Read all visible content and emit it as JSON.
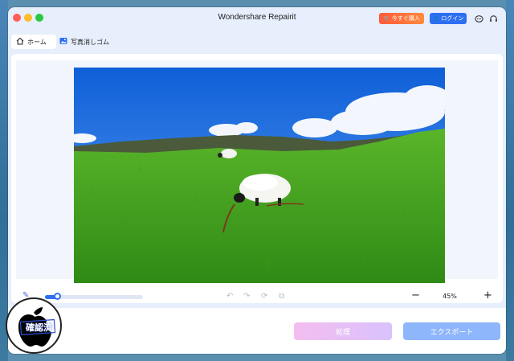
{
  "window": {
    "title": "Wondershare Repairit",
    "buy_label": "今すぐ購入",
    "login_label": "ログイン"
  },
  "tabs": [
    {
      "label": "ホーム",
      "icon": "home-icon",
      "active": true
    },
    {
      "label": "写真消しゴム",
      "icon": "image-icon",
      "active": false
    }
  ],
  "toolbar": {
    "brush_size_percent": 12,
    "zoom": "45%",
    "zoom_out_label": "−",
    "zoom_in_label": "+"
  },
  "footer": {
    "process_label": "処理",
    "export_label": "エクスポート"
  },
  "watermark": {
    "text": "確認済"
  },
  "colors": {
    "accent": "#2d6ff3",
    "buy_orange": "#ff6a3c",
    "export_blue": "#8eb6fb",
    "process_pink": "#f4bdf0"
  }
}
